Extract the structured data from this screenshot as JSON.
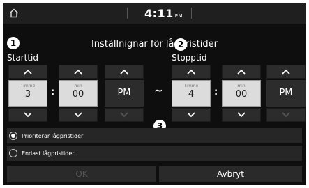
{
  "status": {
    "time": "4:11",
    "ampm": "PM",
    "home_icon": "home-icon"
  },
  "dialog": {
    "title": "Inställnignar för lågpristider",
    "callouts": [
      "1",
      "2",
      "3"
    ]
  },
  "start": {
    "label": "Starttid",
    "hour": {
      "caption": "Timme",
      "value": "3"
    },
    "minute": {
      "caption": "min",
      "value": "00"
    },
    "period": "PM"
  },
  "separator": "~",
  "stop": {
    "label": "Stopptid",
    "hour": {
      "caption": "Timme",
      "value": "4"
    },
    "minute": {
      "caption": "min",
      "value": "00"
    },
    "period": "PM"
  },
  "options": [
    {
      "label": "Prioriterar lågpristider",
      "selected": true
    },
    {
      "label": "Endast lågpristider",
      "selected": false
    }
  ],
  "buttons": {
    "ok": "OK",
    "cancel": "Avbryt"
  }
}
